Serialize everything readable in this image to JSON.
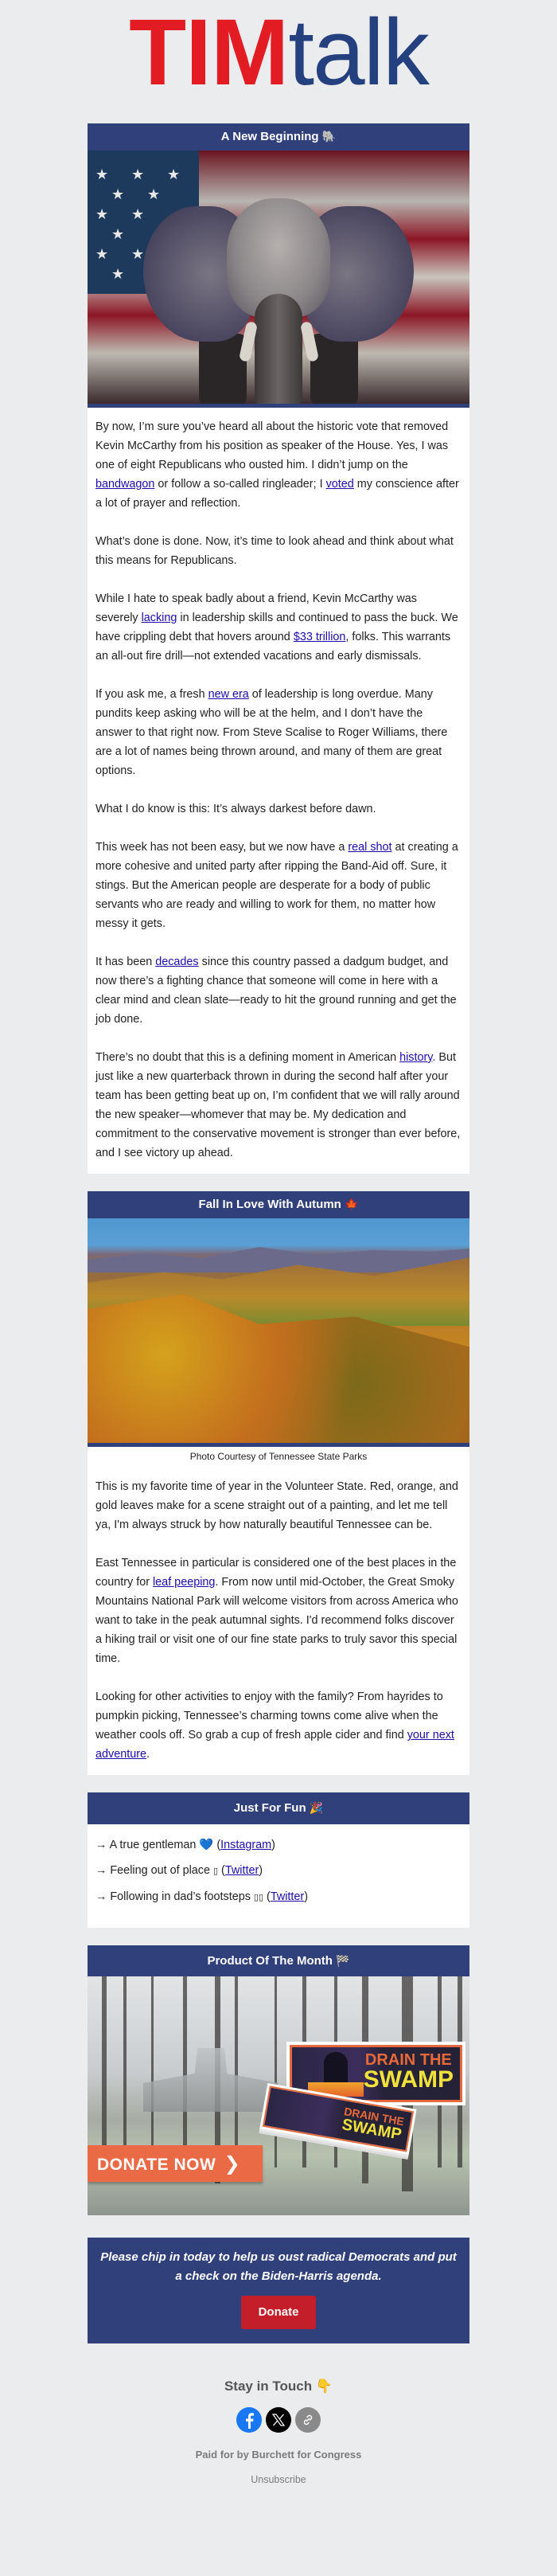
{
  "logo": {
    "part1": "TIM",
    "part2": "talk",
    "color1": "#e31b23",
    "color2": "#25407f"
  },
  "theme": {
    "header_bg": "#30407a",
    "page_bg": "#ebecee",
    "link": "#1a0dab",
    "donate_red": "#c41e2a"
  },
  "sections": {
    "beginning": {
      "title": "A New Beginning",
      "title_icon": "🐘",
      "image_alt": "Elephant in front of American flag",
      "paragraphs": [
        {
          "pre": "By now, I’m sure you’ve heard all about the historic vote that removed Kevin McCarthy from his position as speaker of the House. Yes, I was one of eight Republicans who ousted him. I didn’t jump on the ",
          "link1": "bandwagon",
          "mid": " or follow a so-called ringleader; I ",
          "link2": "voted",
          "post": " my conscience after a lot of prayer and reflection."
        },
        {
          "text": "What’s done is done. Now, it’s time to look ahead and think about what this means for Republicans."
        },
        {
          "pre": "While I hate to speak badly about a friend, Kevin McCarthy was severely ",
          "link1": "lacking",
          "mid": " in leadership skills and continued to pass the buck. We have crippling debt that hovers around ",
          "link2": "$33 trillion",
          "post": ", folks. This warrants an all-out fire drill—not extended vacations and early dismissals."
        },
        {
          "pre": "If you ask me, a fresh ",
          "link": "new era",
          "post": " of leadership is long overdue. Many pundits keep asking who will be at the helm, and I don’t have the answer to that right now. From Steve Scalise to Roger Williams, there are a lot of names being thrown around, and many of them are great options."
        },
        {
          "text": "What I do know is this: It’s always darkest before dawn."
        },
        {
          "pre": "This week has not been easy, but we now have a ",
          "link": "real shot",
          "post": " at creating a more cohesive and united party after ripping the Band-Aid off. Sure, it stings. But the American people are desperate for a body of public servants who are ready and willing to work for them, no matter how messy it gets."
        },
        {
          "pre": "It has been ",
          "link": "decades",
          "post": " since this country passed a dadgum budget, and now there’s a fighting chance that someone will come in here with a clear mind and clean slate—ready to hit the ground running and get the job done."
        },
        {
          "pre": "There’s no doubt that this is a defining moment in American ",
          "link": "history",
          "post": ". But just like a new quarterback thrown in during the second half after your team has been getting beat up on, I’m confident that we will rally around the new speaker—whomever that may be. My dedication and commitment to the conservative movement is stronger than ever before, and I see victory up ahead."
        }
      ]
    },
    "autumn": {
      "title": "Fall In Love With Autumn",
      "title_icon": "🍁",
      "image_alt": "Smoky Mountains in autumn colors",
      "caption": "Photo Courtesy of Tennessee State Parks",
      "paragraphs": [
        {
          "text": "This is my favorite time of year in the Volunteer State. Red, orange, and gold leaves make for a scene straight out of a painting, and let me tell ya, I'm always struck by how naturally beautiful Tennessee can be."
        },
        {
          "pre": "East Tennessee in particular is considered one of the best places in the country for ",
          "link": "leaf peeping",
          "post": ". From now until mid-October, the Great Smoky Mountains National Park will welcome visitors from across America who want to take in the peak autumnal sights. I'd recommend folks discover a hiking trail or visit one of our fine state parks to truly savor this special time."
        },
        {
          "pre": "Looking for other activities to enjoy with the family? From hayrides to pumpkin picking, Tennessee’s charming towns come alive when the weather cools off. So grab a cup of fresh apple cider and find ",
          "link": "your next adventure",
          "post": "."
        }
      ]
    },
    "fun": {
      "title": "Just For Fun",
      "title_icon": "🎉",
      "items": [
        {
          "arrow": "→",
          "text": "A true gentleman",
          "icon": "💙",
          "link": "Instagram"
        },
        {
          "arrow": "→",
          "text": "Feeling out of place",
          "icon": "▯",
          "link": "Twitter"
        },
        {
          "arrow": "→",
          "text": "Following in dad’s footsteps",
          "icon": "▯▯",
          "link": "Twitter"
        }
      ]
    },
    "product": {
      "title": "Product Of The Month",
      "title_icon": "🏁",
      "sticker_line1": "DRAIN THE",
      "sticker_line2": "SWAMP",
      "donate_now_label": "DONATE NOW",
      "donate_now_chevron": "❯"
    }
  },
  "cta": {
    "text": "Please chip in today to help us oust radical Democrats and put a check on the Biden-Harris agenda.",
    "button_label": "Donate"
  },
  "footer": {
    "stay_label": "Stay in Touch",
    "stay_icon": "👇",
    "socials": [
      {
        "name": "facebook",
        "glyph": "f"
      },
      {
        "name": "x",
        "glyph": "𝕏"
      },
      {
        "name": "link",
        "glyph": "🔗"
      }
    ],
    "paid_for": "Paid for by Burchett for Congress",
    "unsubscribe": "Unsubscribe"
  }
}
